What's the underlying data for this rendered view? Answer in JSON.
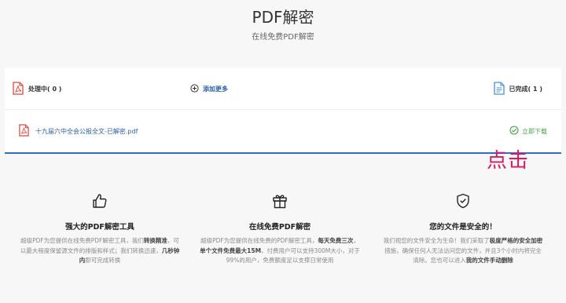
{
  "header": {
    "title": "PDF解密",
    "subtitle": "在线免费PDF解密"
  },
  "panel": {
    "processing_label": "处理中( 0 )",
    "add_more_label": "添加更多",
    "done_label": "已完成( 1 )",
    "file": {
      "name": "十九届六中全会公报全文-已解密.pdf",
      "download_label": "立即下载"
    }
  },
  "annotation": {
    "text": "点击",
    "color": "#d81b60"
  },
  "features": [
    {
      "icon": "thumbs-up-icon",
      "title": "强大的PDF解密工具",
      "parts": [
        "超级PDF为您提供在线免费PDF解密工具，我们",
        "转换精准",
        "，可以最大程度保留源文件的排版和样式；我们转换迅速，",
        "几秒钟内",
        "即可完成转换"
      ]
    },
    {
      "icon": "gift-icon",
      "title": "在线免费PDF解密",
      "parts": [
        "超级PDF为您提供在线免费的PDF解密工具，",
        "每天免费三次",
        "，",
        "单个文件免费最大15M",
        "，付费用户可以支持300M大小，对于99%的用户，免费额度足以支撑日常使用"
      ]
    },
    {
      "icon": "shield-check-icon",
      "title": "您的文件是安全的！",
      "parts": [
        "我们视您的文件安全为生命！我们采取了",
        "极度严格的安全加密",
        "措施，确保任何人无法访问您的文件，并且3个小时内将完全清除。您也可以进入",
        "我的文件手动删除",
        ""
      ]
    }
  ],
  "colors": {
    "link": "#2b5fa8",
    "success": "#45a046",
    "pdf_red": "#e0463a",
    "done_blue": "#4a90d9",
    "panel_border": "#2f6fb8"
  }
}
